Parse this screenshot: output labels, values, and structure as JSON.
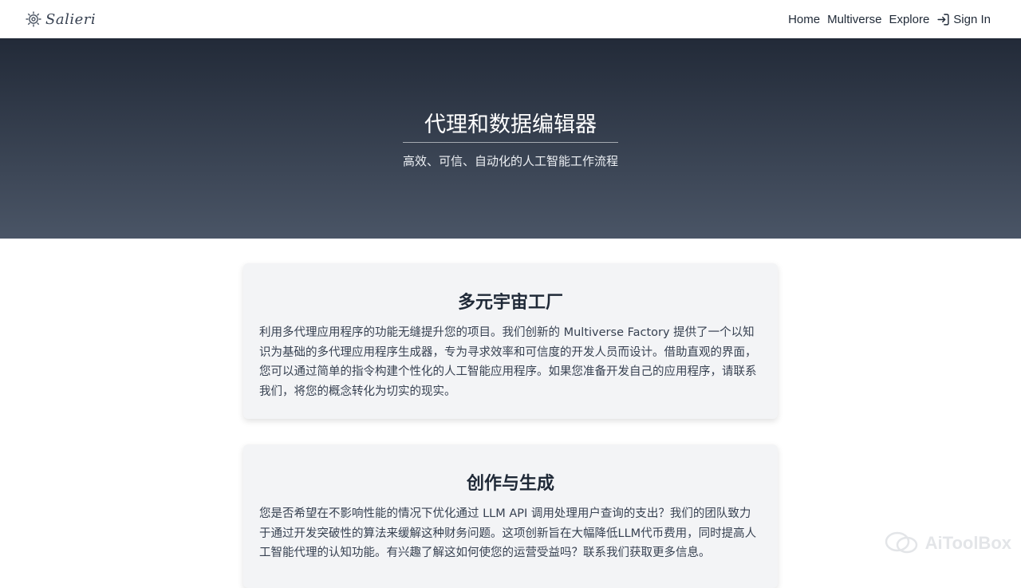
{
  "navbar": {
    "brand": {
      "name": "Salieri",
      "icon": "gear-logo-icon"
    },
    "links": [
      {
        "label": "Home"
      },
      {
        "label": "Multiverse"
      },
      {
        "label": "Explore"
      },
      {
        "label": "Sign In",
        "icon": "sign-in-icon"
      }
    ]
  },
  "hero": {
    "title": "代理和数据编辑器",
    "subtitle": "高效、可信、自动化的人工智能工作流程"
  },
  "cards": [
    {
      "title": "多元宇宙工厂",
      "text": "利用多代理应用程序的功能无缝提升您的项目。我们创新的 Multiverse Factory 提供了一个以知识为基础的多代理应用程序生成器，专为寻求效率和可信度的开发人员而设计。借助直观的界面，您可以通过简单的指令构建个性化的人工智能应用程序。如果您准备开发自己的应用程序，请联系我们，将您的概念转化为切实的现实。"
    },
    {
      "title": "创作与生成",
      "text": "您是否希望在不影响性能的情况下优化通过 LLM API 调用处理用户查询的支出？我们的团队致力于通过开发突破性的算法来缓解这种财务问题。这项创新旨在大幅降低LLM代币费用，同时提高人工智能代理的认知功能。有兴趣了解这如何使您的运营受益吗？联系我们获取更多信息。"
    }
  ],
  "watermark": {
    "text": "AiToolBox",
    "icon": "chat-bubble-icon"
  },
  "colors": {
    "hero_top": "#222a38",
    "hero_bottom": "#4a5566",
    "card_bg": "#f3f4f6",
    "text_dark": "#1f2937"
  }
}
